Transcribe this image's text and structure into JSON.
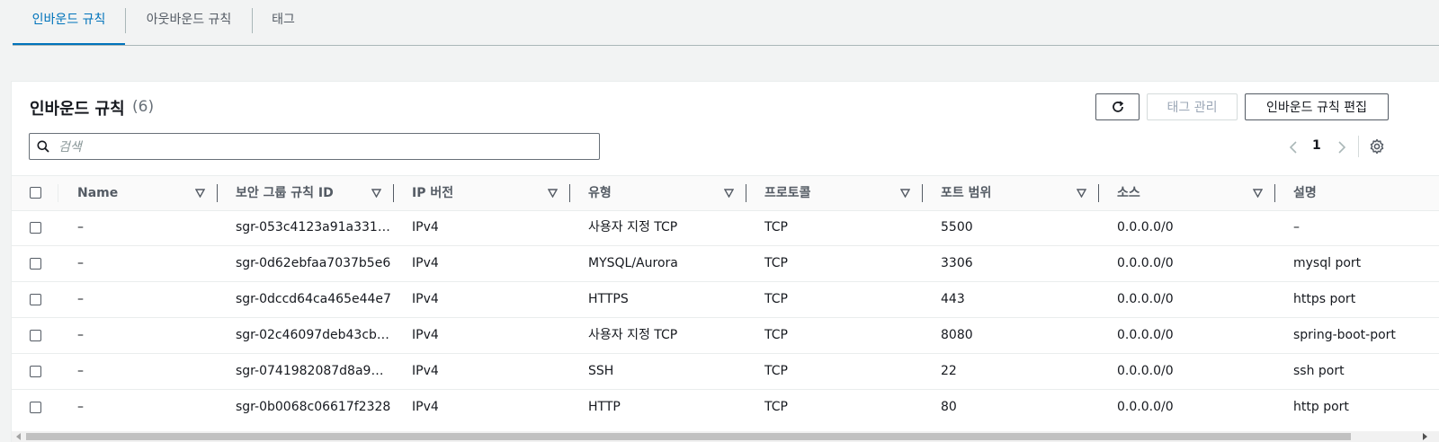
{
  "tabs": [
    {
      "label": "인바운드 규칙",
      "active": true
    },
    {
      "label": "아웃바운드 규칙",
      "active": false
    },
    {
      "label": "태그",
      "active": false
    }
  ],
  "panel": {
    "title": "인바운드 규칙",
    "count": "(6)",
    "buttons": {
      "refresh_icon": "refresh-icon",
      "manage_tags": "태그 관리",
      "edit_inbound": "인바운드 규칙 편집"
    },
    "search": {
      "placeholder": "검색",
      "value": ""
    },
    "pager": {
      "page": "1"
    }
  },
  "table": {
    "columns": [
      "Name",
      "보안 그룹 규칙 ID",
      "IP 버전",
      "유형",
      "프로토콜",
      "포트 범위",
      "소스",
      "설명"
    ],
    "rows": [
      {
        "name": "–",
        "rule_id": "sgr-053c4123a91a331…",
        "ip_version": "IPv4",
        "type": "사용자 지정 TCP",
        "protocol": "TCP",
        "port": "5500",
        "source": "0.0.0.0/0",
        "description": "–"
      },
      {
        "name": "–",
        "rule_id": "sgr-0d62ebfaa7037b5e6",
        "ip_version": "IPv4",
        "type": "MYSQL/Aurora",
        "protocol": "TCP",
        "port": "3306",
        "source": "0.0.0.0/0",
        "description": "mysql port"
      },
      {
        "name": "–",
        "rule_id": "sgr-0dccd64ca465e44e7",
        "ip_version": "IPv4",
        "type": "HTTPS",
        "protocol": "TCP",
        "port": "443",
        "source": "0.0.0.0/0",
        "description": "https port"
      },
      {
        "name": "–",
        "rule_id": "sgr-02c46097deb43cb…",
        "ip_version": "IPv4",
        "type": "사용자 지정 TCP",
        "protocol": "TCP",
        "port": "8080",
        "source": "0.0.0.0/0",
        "description": "spring-boot-port"
      },
      {
        "name": "–",
        "rule_id": "sgr-0741982087d8a9…",
        "ip_version": "IPv4",
        "type": "SSH",
        "protocol": "TCP",
        "port": "22",
        "source": "0.0.0.0/0",
        "description": "ssh port"
      },
      {
        "name": "–",
        "rule_id": "sgr-0b0068c06617f2328",
        "ip_version": "IPv4",
        "type": "HTTP",
        "protocol": "TCP",
        "port": "80",
        "source": "0.0.0.0/0",
        "description": "http port"
      }
    ]
  },
  "colors": {
    "accent": "#0073bb",
    "text": "#16191f",
    "muted": "#545b64"
  }
}
